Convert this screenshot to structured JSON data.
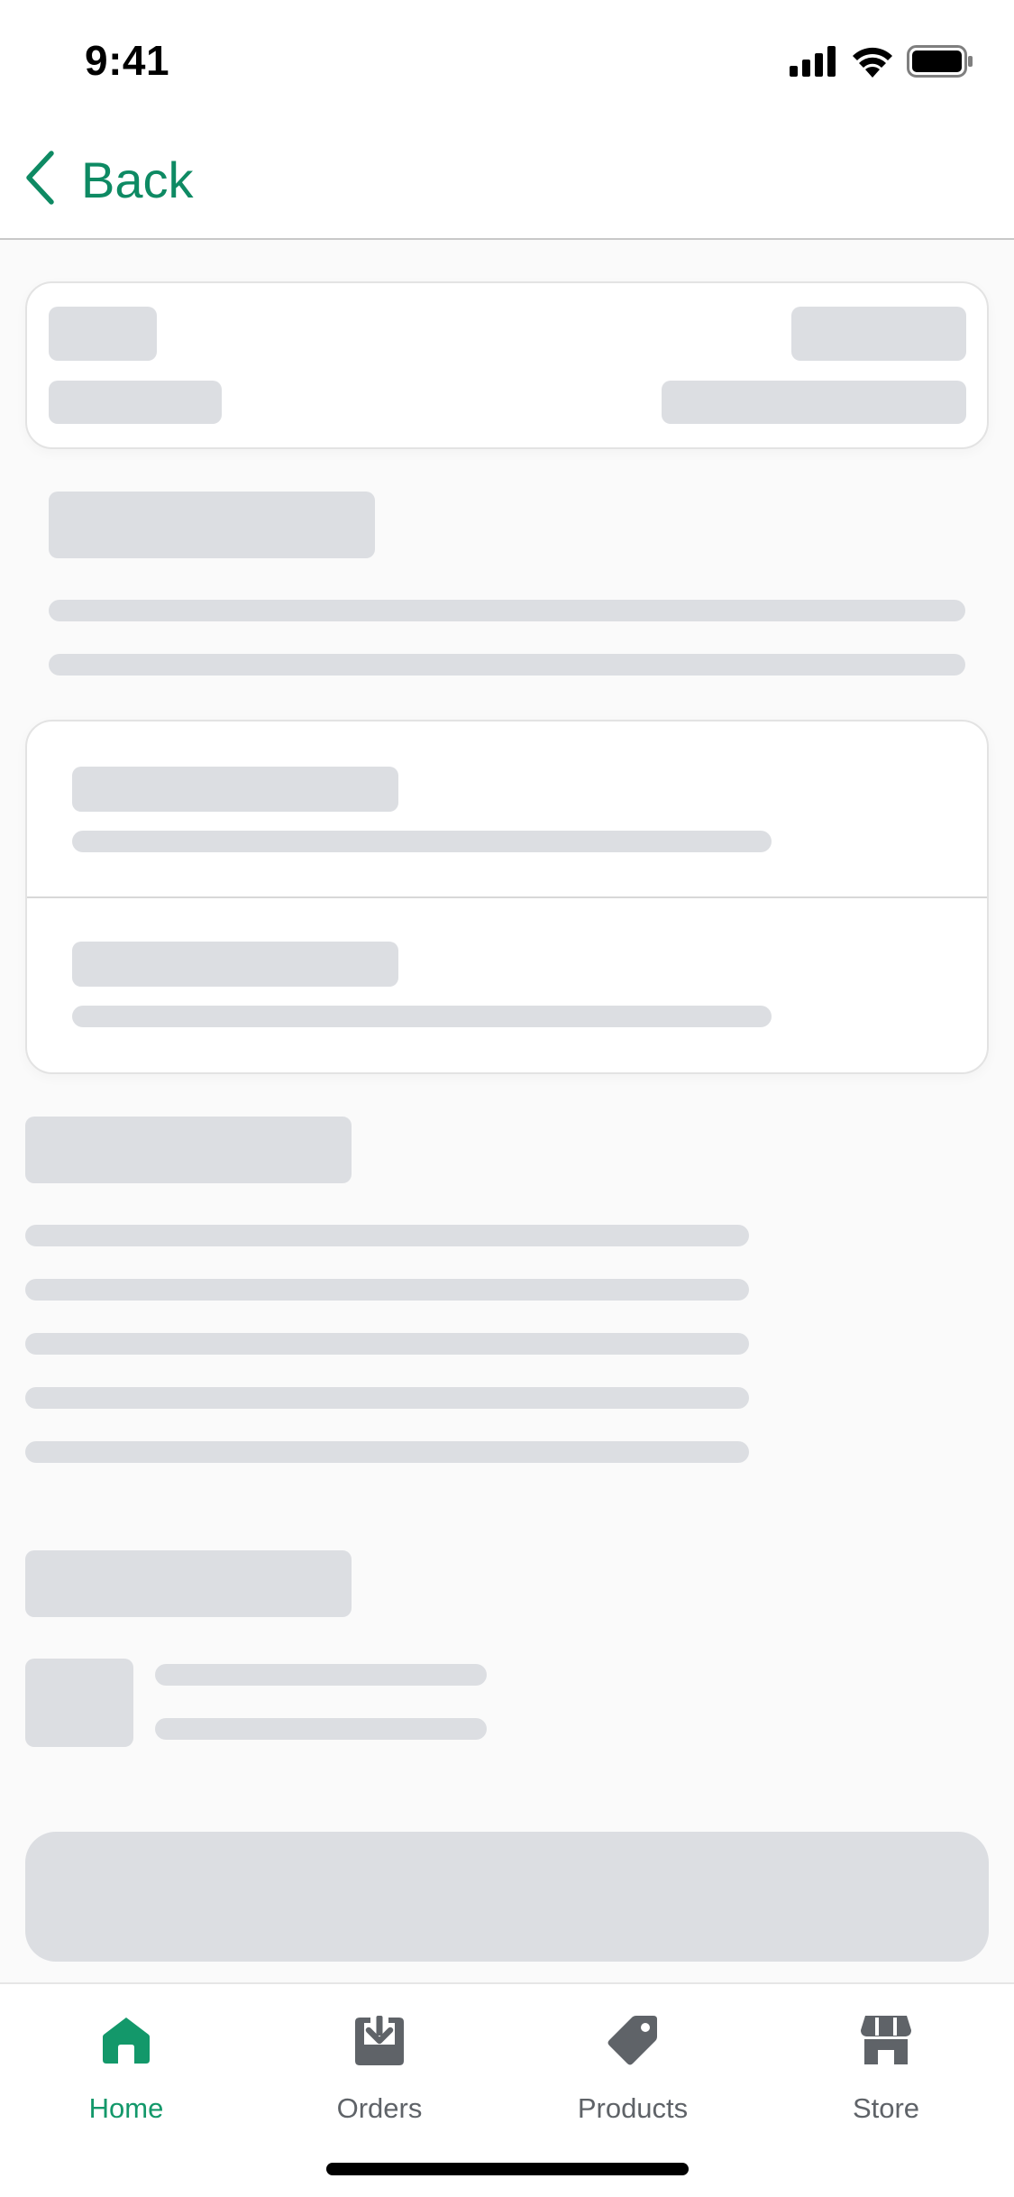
{
  "status_bar": {
    "time": "9:41",
    "icons": [
      "signal-icon",
      "wifi-icon",
      "battery-icon"
    ]
  },
  "nav": {
    "back_label": "Back",
    "back_icon": "chevron-left-icon"
  },
  "tabs": [
    {
      "id": "home",
      "label": "Home",
      "icon": "home-icon",
      "active": true
    },
    {
      "id": "orders",
      "label": "Orders",
      "icon": "inbox-download-icon",
      "active": false
    },
    {
      "id": "products",
      "label": "Products",
      "icon": "tag-icon",
      "active": false
    },
    {
      "id": "store",
      "label": "Store",
      "icon": "storefront-icon",
      "active": false
    }
  ],
  "colors": {
    "accent": "#0e8a63",
    "active_tab": "#13986a",
    "inactive_tab": "#5f6368",
    "skeleton": "#dcdee2",
    "background": "#fafafa"
  }
}
